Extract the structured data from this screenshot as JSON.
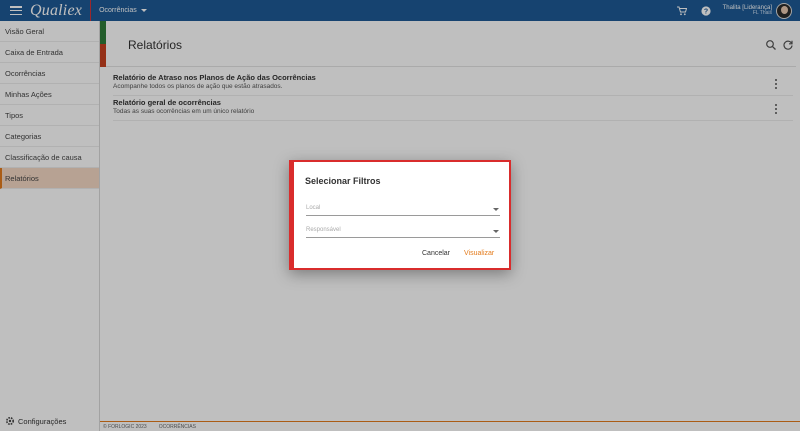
{
  "topbar": {
    "logo": "Qualiex",
    "module": "Ocorrências",
    "user_name": "Thalita [Liderança]",
    "user_sub": "FL Thais",
    "icons": [
      "cart-icon",
      "help-icon"
    ]
  },
  "sidebar": {
    "items": [
      {
        "label": "Visão Geral"
      },
      {
        "label": "Caixa de Entrada"
      },
      {
        "label": "Ocorrências"
      },
      {
        "label": "Minhas Ações"
      },
      {
        "label": "Tipos"
      },
      {
        "label": "Categorias"
      },
      {
        "label": "Classificação de causa"
      },
      {
        "label": "Relatórios"
      }
    ],
    "settings": "Configurações"
  },
  "main": {
    "title": "Relatórios",
    "reports": [
      {
        "title": "Relatório de Atraso nos Planos de Ação das Ocorrências",
        "desc": "Acompanhe todos os planos de ação que estão atrasados."
      },
      {
        "title": "Relatório geral de ocorrências",
        "desc": "Todas as suas ocorrências em um único relatório"
      }
    ]
  },
  "footer": {
    "copyright": "© FORLOGIC 2023",
    "module": "OCORRÊNCIAS"
  },
  "dialog": {
    "title": "Selecionar Filtros",
    "field_local": "Local",
    "field_responsavel": "Responsável",
    "cancel": "Cancelar",
    "view": "Visualizar"
  },
  "colors": {
    "topbar": "#1e5a96",
    "accent": "#e37b1c",
    "dialog_border": "#d92c2c"
  }
}
